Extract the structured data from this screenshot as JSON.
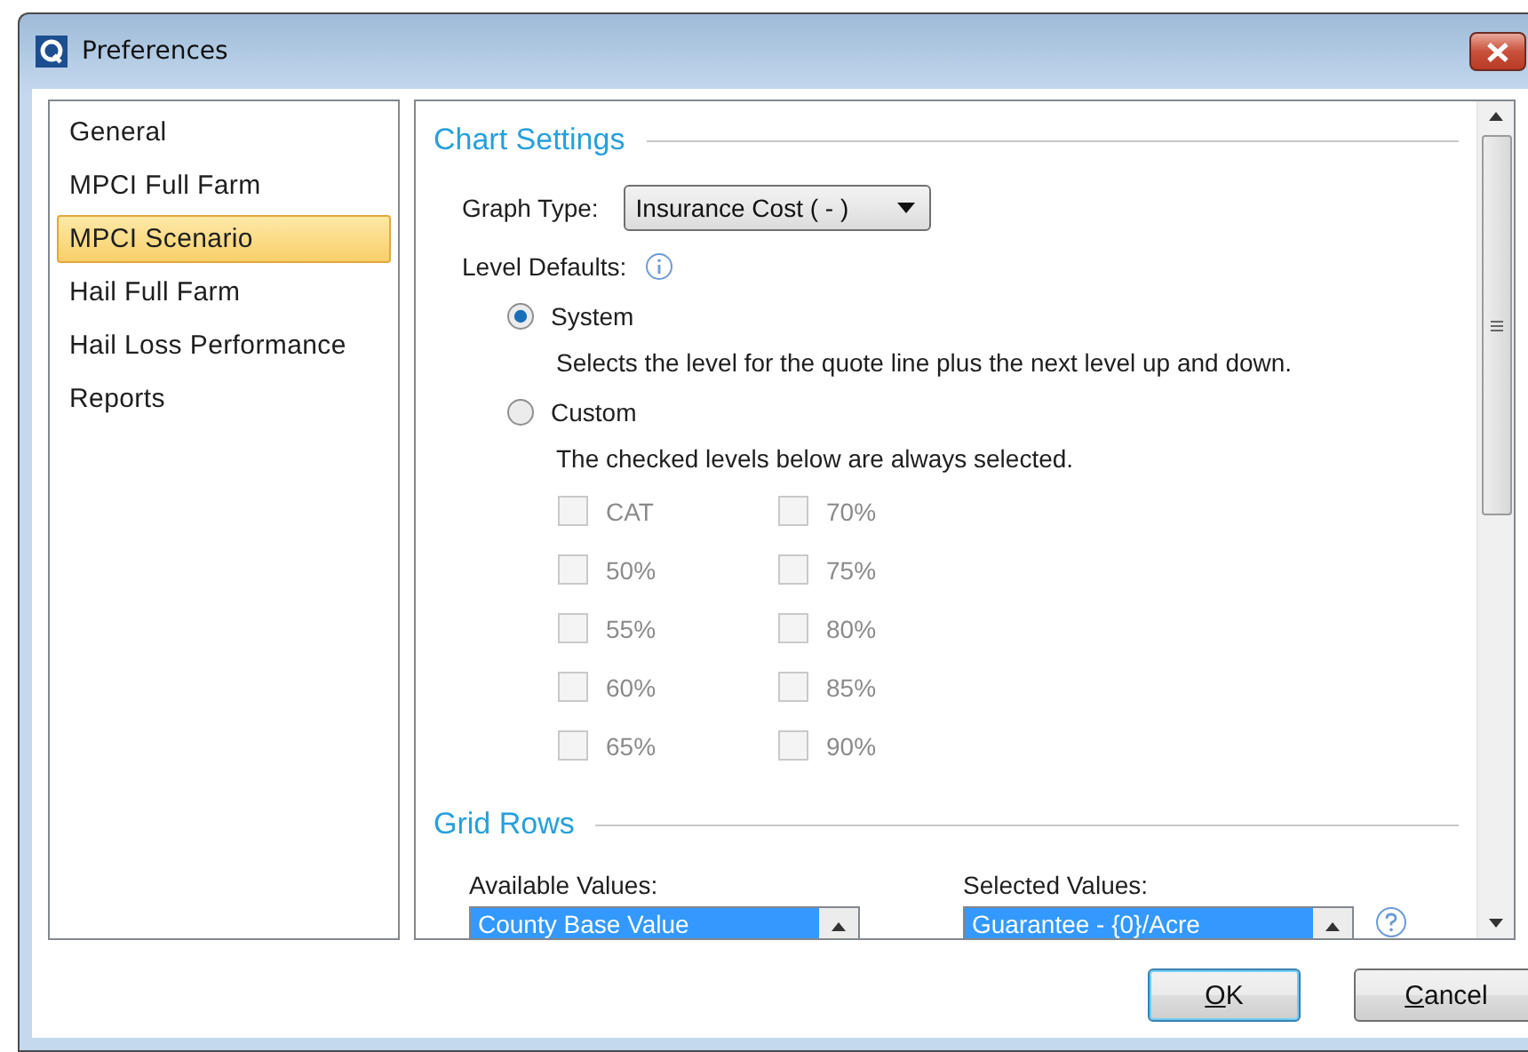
{
  "window": {
    "title": "Preferences"
  },
  "sidebar": {
    "items": [
      {
        "label": "General",
        "selected": false
      },
      {
        "label": "MPCI Full Farm",
        "selected": false
      },
      {
        "label": "MPCI Scenario",
        "selected": true
      },
      {
        "label": "Hail Full Farm",
        "selected": false
      },
      {
        "label": "Hail Loss Performance",
        "selected": false
      },
      {
        "label": "Reports",
        "selected": false
      }
    ]
  },
  "chart_settings": {
    "title": "Chart Settings",
    "graph_type": {
      "label": "Graph Type:",
      "value": "Insurance Cost ( - )"
    },
    "level_defaults": {
      "label": "Level Defaults:"
    },
    "options": [
      {
        "label": "System",
        "description": "Selects the level for the quote line plus the next level up and down.",
        "selected": true
      },
      {
        "label": "Custom",
        "description": "The checked levels below are always selected.",
        "selected": false
      }
    ],
    "levels": [
      {
        "label": "CAT",
        "checked": false,
        "disabled": true
      },
      {
        "label": "70%",
        "checked": false,
        "disabled": true
      },
      {
        "label": "50%",
        "checked": false,
        "disabled": true
      },
      {
        "label": "75%",
        "checked": false,
        "disabled": true
      },
      {
        "label": "55%",
        "checked": false,
        "disabled": true
      },
      {
        "label": "80%",
        "checked": false,
        "disabled": true
      },
      {
        "label": "60%",
        "checked": false,
        "disabled": true
      },
      {
        "label": "85%",
        "checked": false,
        "disabled": true
      },
      {
        "label": "65%",
        "checked": false,
        "disabled": true
      },
      {
        "label": "90%",
        "checked": false,
        "disabled": true
      }
    ]
  },
  "grid_rows": {
    "title": "Grid Rows",
    "available_values": {
      "label": "Available Values:",
      "items": [
        {
          "label": "County Base Value",
          "selected": true
        }
      ]
    },
    "selected_values": {
      "label": "Selected Values:",
      "items": [
        {
          "label": "Guarantee - {0}/Acre",
          "selected": true
        }
      ]
    }
  },
  "buttons": [
    {
      "label": "OK",
      "default": true
    },
    {
      "label": "Cancel",
      "default": false
    }
  ]
}
